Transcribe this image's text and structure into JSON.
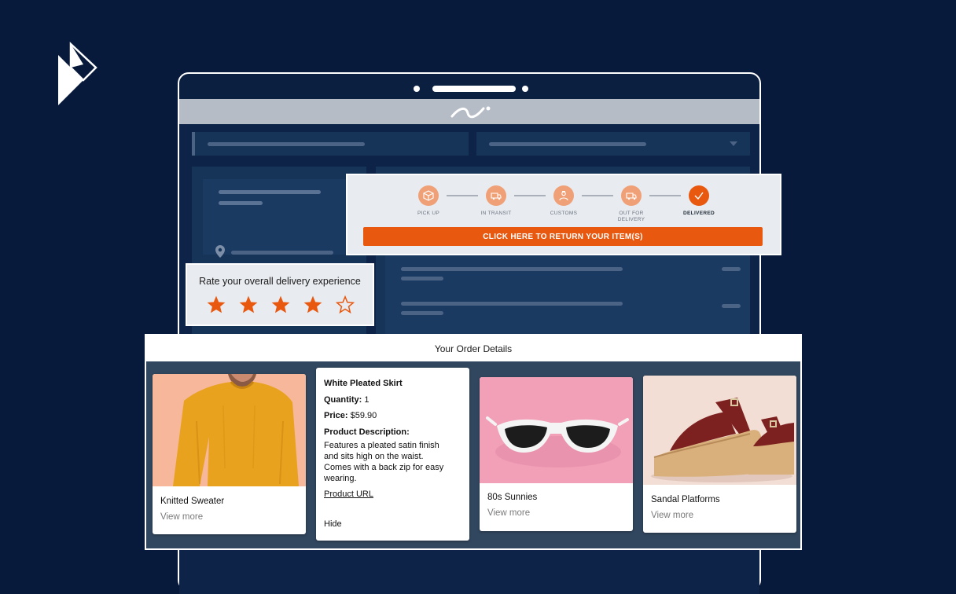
{
  "tracking": {
    "steps": [
      {
        "label": "PICK UP",
        "icon": "package-icon",
        "active": false
      },
      {
        "label": "IN TRANSIT",
        "icon": "truck-icon",
        "active": false
      },
      {
        "label": "CUSTOMS",
        "icon": "customs-officer-icon",
        "active": false
      },
      {
        "label": "OUT FOR\nDELIVERY",
        "icon": "delivery-truck-icon",
        "active": false
      },
      {
        "label": "DELIVERED",
        "icon": "checkmark-icon",
        "active": true
      }
    ],
    "return_button_label": "CLICK HERE TO RETURN YOUR ITEM(S)",
    "accent_color": "#e9580f",
    "inactive_color": "#f0a077"
  },
  "rating": {
    "title": "Rate your overall delivery experience",
    "value": 4,
    "max": 5
  },
  "order": {
    "title": "Your Order Details",
    "products": [
      {
        "name": "Knitted Sweater",
        "link_label": "View more"
      },
      {
        "name": "80s Sunnies",
        "link_label": "View more"
      },
      {
        "name": "Sandal Platforms",
        "link_label": "View more"
      }
    ],
    "expanded_product": {
      "name": "White Pleated Skirt",
      "quantity_label": "Quantity:",
      "quantity_value": " 1",
      "price_label": "Price:",
      "price_value": " $59.90",
      "description_label": "Product Description:",
      "description_lines": [
        "Features a pleated satin finish",
        "and sits high on the waist.",
        "Comes with a back zip for easy",
        "wearing."
      ],
      "url_label": "Product URL",
      "hide_label": "Hide"
    }
  }
}
